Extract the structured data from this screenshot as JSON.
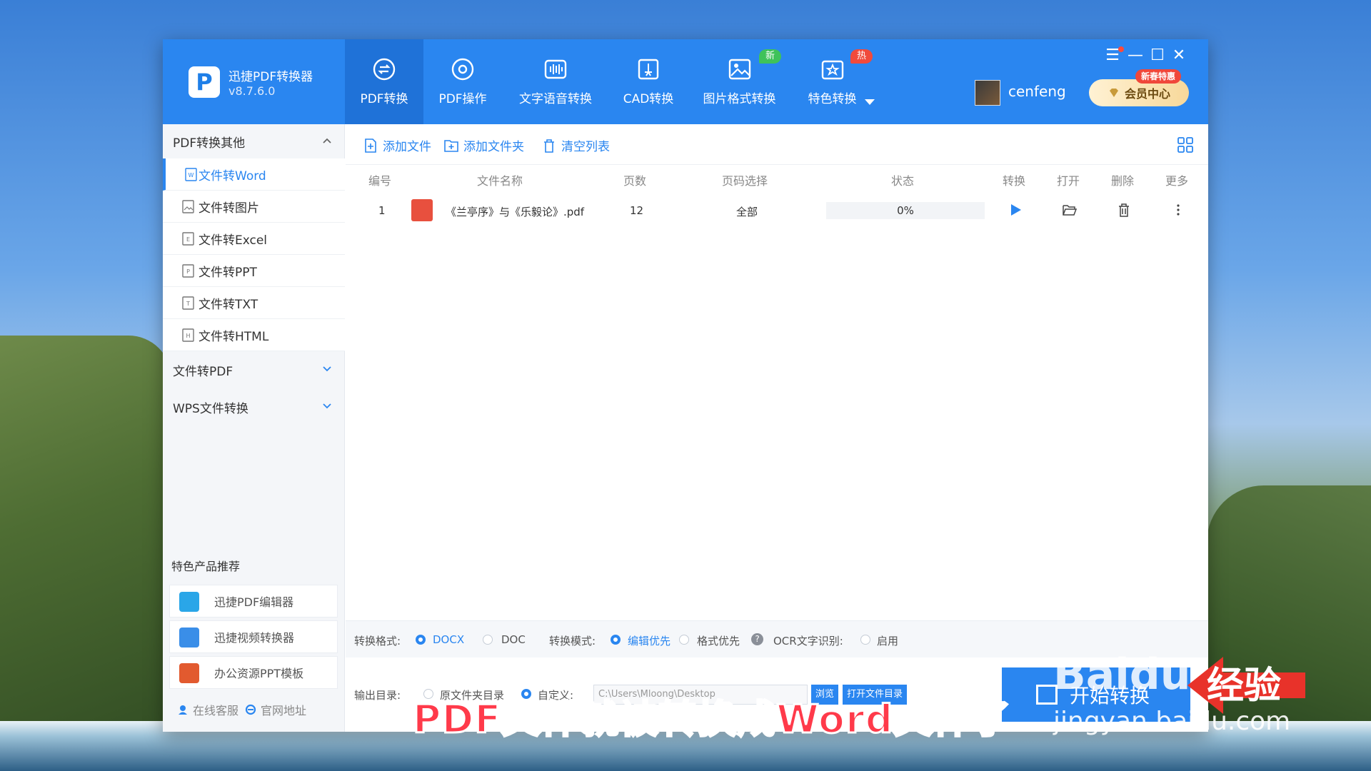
{
  "app": {
    "title": "迅捷PDF转换器",
    "version": "v8.7.6.0",
    "logo_letter": "P"
  },
  "nav_tabs": [
    {
      "label": "PDF转换",
      "icon": "pdf-convert-icon",
      "active": true
    },
    {
      "label": "PDF操作",
      "icon": "pdf-operate-icon"
    },
    {
      "label": "文字语音转换",
      "icon": "voice-icon"
    },
    {
      "label": "CAD转换",
      "icon": "cad-icon"
    },
    {
      "label": "图片格式转换",
      "icon": "image-icon",
      "badge": "新"
    },
    {
      "label": "特色转换",
      "icon": "star-convert-icon",
      "badge": "热"
    }
  ],
  "user": {
    "name": "cenfeng",
    "vip_label": "会员中心",
    "vip_tag": "新春特惠"
  },
  "window_controls": [
    "☰",
    "—",
    "☐",
    "✕"
  ],
  "sidebar": {
    "groups": [
      {
        "label": "PDF转换其他",
        "expanded": true
      },
      {
        "label": "文件转PDF",
        "expanded": false
      },
      {
        "label": "WPS文件转换",
        "expanded": false
      }
    ],
    "items": [
      {
        "label": "文件转Word",
        "icon_letter": "W"
      },
      {
        "label": "文件转图片",
        "icon_letter": "▨"
      },
      {
        "label": "文件转Excel",
        "icon_letter": "E"
      },
      {
        "label": "文件转PPT",
        "icon_letter": "P"
      },
      {
        "label": "文件转TXT",
        "icon_letter": "T"
      },
      {
        "label": "文件转HTML",
        "icon_letter": "H"
      }
    ],
    "recommend_title": "特色产品推荐",
    "recommend": [
      {
        "label": "迅捷PDF编辑器",
        "color": "#2aa6e8"
      },
      {
        "label": "迅捷视频转换器",
        "color": "#3a8ee8"
      },
      {
        "label": "办公资源PPT模板",
        "color": "#e25a2f"
      }
    ],
    "footer": {
      "service": "在线客服",
      "website": "官网地址"
    }
  },
  "toolbar": {
    "add_file": "添加文件",
    "add_folder": "添加文件夹",
    "clear_list": "清空列表"
  },
  "table": {
    "headers": [
      "编号",
      "文件名称",
      "页数",
      "页码选择",
      "状态",
      "转换",
      "打开",
      "删除",
      "更多"
    ],
    "rows": [
      {
        "index": "1",
        "name": "《兰亭序》与《乐毅论》.pdf",
        "pages": "12",
        "page_select": "全部",
        "progress": "0%",
        "progress_value": 0
      }
    ]
  },
  "options": {
    "format_label": "转换格式:",
    "format_docx": "DOCX",
    "format_doc": "DOC",
    "mode_label": "转换模式:",
    "mode_edit": "编辑优先",
    "mode_format": "格式优先",
    "ocr_label": "OCR文字识别:",
    "ocr_enable": "启用",
    "output_label": "输出目录:",
    "output_original": "原文件夹目录",
    "output_custom": "自定义:",
    "output_path": "C:\\Users\\Mloong\\Desktop",
    "browse": "浏览",
    "open_folder": "打开文件目录",
    "start_button": "开始转换"
  },
  "overlay": {
    "caption": "PDF文件就被转换成Word文件了",
    "watermark_brand": "Baidu",
    "watermark_jy": "经验",
    "watermark_url": "jingyan.baidu.com"
  },
  "colors": {
    "accent": "#2a86f0",
    "header": "#2a86f0",
    "caption": "#ff3a4a"
  }
}
